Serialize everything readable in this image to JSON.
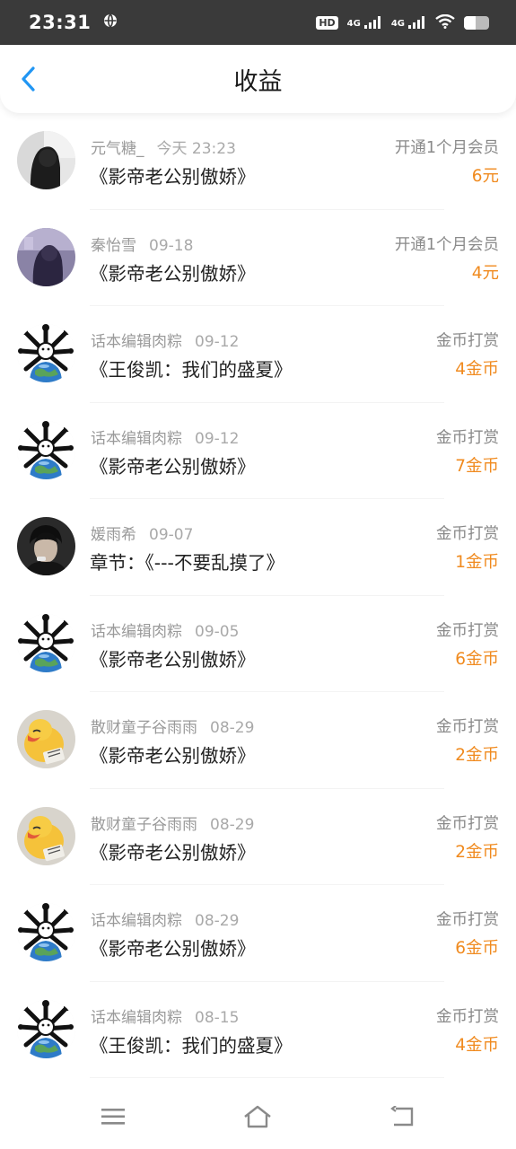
{
  "status": {
    "time": "23:31",
    "battery_level": 0.45,
    "network_labels": [
      "HD",
      "4G",
      "4G"
    ]
  },
  "header": {
    "title": "收益"
  },
  "colors": {
    "accent": "#2196f3",
    "amount": "#f08a1e"
  },
  "records": [
    {
      "user": "元气糖_",
      "date": "今天 23:23",
      "title": "《影帝老公别傲娇》",
      "type": "开通1个月会员",
      "amount": "6元",
      "avatar": "girl-dark"
    },
    {
      "user": "秦怡雪",
      "date": "09-18",
      "title": "《影帝老公别傲娇》",
      "type": "开通1个月会员",
      "amount": "4元",
      "avatar": "girl-purple"
    },
    {
      "user": "话本编辑肉粽",
      "date": "09-12",
      "title": "《王俊凯：我们的盛夏》",
      "type": "金币打赏",
      "amount": "4金币",
      "avatar": "globe-monster"
    },
    {
      "user": "话本编辑肉粽",
      "date": "09-12",
      "title": "《影帝老公别傲娇》",
      "type": "金币打赏",
      "amount": "7金币",
      "avatar": "globe-monster"
    },
    {
      "user": "媛雨希",
      "date": "09-07",
      "title": "章节：《---不要乱摸了》",
      "type": "金币打赏",
      "amount": "1金币",
      "avatar": "boy-dark"
    },
    {
      "user": "话本编辑肉粽",
      "date": "09-05",
      "title": "《影帝老公别傲娇》",
      "type": "金币打赏",
      "amount": "6金币",
      "avatar": "globe-monster"
    },
    {
      "user": "散财童子谷雨雨",
      "date": "08-29",
      "title": "《影帝老公别傲娇》",
      "type": "金币打赏",
      "amount": "2金币",
      "avatar": "yellow-duck"
    },
    {
      "user": "散财童子谷雨雨",
      "date": "08-29",
      "title": "《影帝老公别傲娇》",
      "type": "金币打赏",
      "amount": "2金币",
      "avatar": "yellow-duck"
    },
    {
      "user": "话本编辑肉粽",
      "date": "08-29",
      "title": "《影帝老公别傲娇》",
      "type": "金币打赏",
      "amount": "6金币",
      "avatar": "globe-monster"
    },
    {
      "user": "话本编辑肉粽",
      "date": "08-15",
      "title": "《王俊凯：我们的盛夏》",
      "type": "金币打赏",
      "amount": "4金币",
      "avatar": "globe-monster"
    }
  ]
}
